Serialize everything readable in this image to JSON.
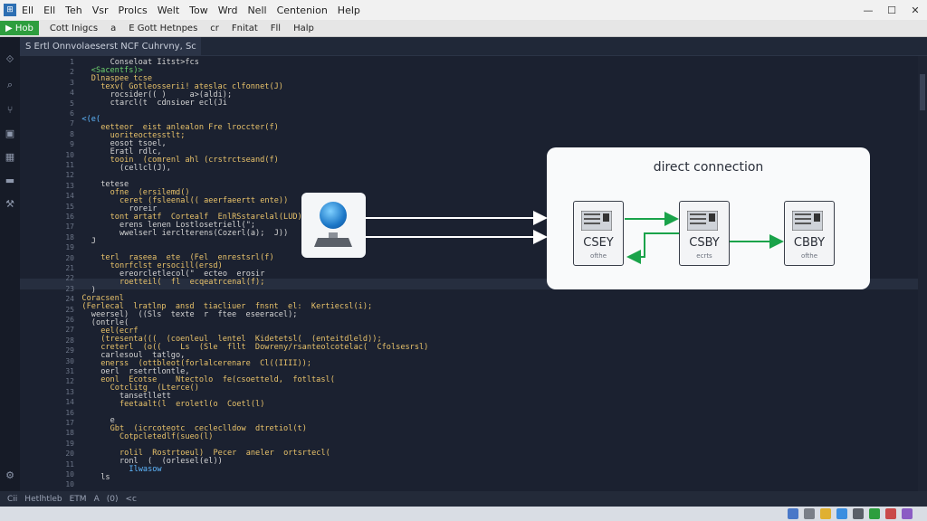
{
  "menubar": {
    "logo": "⊞",
    "items": [
      "Ell",
      "Ell",
      "Teh",
      "Vsr",
      "Prolcs",
      "Welt",
      "Tow",
      "Wrd",
      "Nell",
      "Centenion",
      "Help"
    ]
  },
  "toolbar": {
    "run_label": "Hob",
    "items": [
      "Cott Inigcs",
      "a",
      "E Gott Hetnpes",
      "cr",
      "Fnitat",
      "Fll",
      "Halp"
    ]
  },
  "tab": {
    "label": "S Ertl Onnvolaeserst NCF Cuhrvny, Sc"
  },
  "line_numbers": [
    "1",
    "2",
    "3",
    "4",
    "5",
    "6",
    "7",
    "8",
    "9",
    "10",
    "11",
    "12",
    "13",
    "14",
    "15",
    "16",
    "17",
    "18",
    "19",
    "20",
    "21",
    "22",
    "23",
    "24",
    "25",
    "26",
    "27",
    "28",
    "29",
    "30",
    "31",
    "12",
    "13",
    "14",
    "16",
    "17",
    "18",
    "19",
    "20",
    "11",
    "10",
    "10"
  ],
  "code_lines": [
    {
      "indent": 8,
      "text": "Conseloat Iitst>fcs",
      "color": "#d4d4d4"
    },
    {
      "indent": 4,
      "text": "<Sacentfs)>",
      "color": "#6fd36f"
    },
    {
      "indent": 4,
      "text": "Dlnaspee tcse",
      "color": "#e8c26a"
    },
    {
      "indent": 6,
      "text": "texv( Gotleosserii! ateslac clfonnet(J)",
      "color": "#e8c26a"
    },
    {
      "indent": 8,
      "text": "rocsider(( )     a>(aldi);",
      "color": "#d4d4d4"
    },
    {
      "indent": 8,
      "text": "ctarcl(t  cdnsioer ecl(Ji",
      "color": "#d4d4d4"
    },
    {
      "indent": 0,
      "text": "",
      "color": "#d4d4d4"
    },
    {
      "indent": 2,
      "text": "<(e(",
      "color": "#5fb8ff"
    },
    {
      "indent": 6,
      "text": "eetteor  eist anlealon Fre lroccter(f)",
      "color": "#e8c26a"
    },
    {
      "indent": 8,
      "text": "uoriteoctesstlt;",
      "color": "#e8c26a"
    },
    {
      "indent": 8,
      "text": "eosot tsoel,",
      "color": "#d4d4d4"
    },
    {
      "indent": 8,
      "text": "Eratl rdlc,",
      "color": "#d4d4d4"
    },
    {
      "indent": 8,
      "text": "tooin  (comrenl ahl (crstrctseand(f)",
      "color": "#e8c26a"
    },
    {
      "indent": 10,
      "text": "(cellcl(J),",
      "color": "#d4d4d4"
    },
    {
      "indent": 0,
      "text": "",
      "color": "#d4d4d4"
    },
    {
      "indent": 6,
      "text": "tetese",
      "color": "#d4d4d4"
    },
    {
      "indent": 8,
      "text": "ofne  (ersilemd()",
      "color": "#e8c26a"
    },
    {
      "indent": 10,
      "text": "ceret (fsleenal(( aeerfaeertt ente))",
      "color": "#e8c26a"
    },
    {
      "indent": 12,
      "text": "roreir",
      "color": "#d4d4d4"
    },
    {
      "indent": 8,
      "text": "tont artatf  Cortealf  EnlRSstarelal(LUD);",
      "color": "#e8c26a"
    },
    {
      "indent": 10,
      "text": "erens lenen Lostlosetriell(\";",
      "color": "#d4d4d4"
    },
    {
      "indent": 10,
      "text": "wwelserl ierclterens(Cozerl(a);  J))",
      "color": "#d4d4d4"
    },
    {
      "indent": 4,
      "text": "J",
      "color": "#d4d4d4"
    },
    {
      "indent": 0,
      "text": "",
      "color": "#d4d4d4"
    },
    {
      "indent": 6,
      "text": "terl  raseea  ete  (Fel  enrestsrl(f)",
      "color": "#e8c26a"
    },
    {
      "indent": 8,
      "text": "tonrfclst ersocill(ersd)",
      "color": "#e8c26a"
    },
    {
      "indent": 10,
      "text": "ereorcletlecol(\"  ecteo  erosir",
      "color": "#d4d4d4"
    },
    {
      "indent": 10,
      "text": "roetteil(  fl  ecqeatrcenal(f);",
      "color": "#e8c26a"
    },
    {
      "indent": 4,
      "text": ")",
      "color": "#d4d4d4"
    },
    {
      "indent": 2,
      "text": "Coracsenl",
      "color": "#e8c26a"
    },
    {
      "indent": 2,
      "text": "(Ferlecal  lratlnp  ansd  tiacliuer  fnsnt  el:  Kertiecsl(i);",
      "color": "#e8c26a"
    },
    {
      "indent": 4,
      "text": "weersel)  ((Sls  texte  r  ftee  eseeracel);",
      "color": "#d4d4d4"
    },
    {
      "indent": 4,
      "text": "(ontrle(",
      "color": "#d4d4d4"
    },
    {
      "indent": 6,
      "text": "eel(ecrf",
      "color": "#e8c26a"
    },
    {
      "indent": 6,
      "text": "(tresenta(((  (coenleul  lentel  Kidetetsl(  (enteitdleld));",
      "color": "#e8c26a"
    },
    {
      "indent": 6,
      "text": "creterl  (o((    Ls  (Sle  fllt  Dowreny/rsanteolcotelac(  Cfolsesrsl)",
      "color": "#e8c26a"
    },
    {
      "indent": 6,
      "text": "carlesoul  tatlgo,",
      "color": "#d4d4d4"
    },
    {
      "indent": 6,
      "text": "enerss  (ottbleot(forlalcerenare  Cl((IIII));",
      "color": "#e8c26a"
    },
    {
      "indent": 6,
      "text": "oerl  rsetrtlontle,",
      "color": "#d4d4d4"
    },
    {
      "indent": 6,
      "text": "eonl  Ecotse    Ntectolo  fe(csoetteld,  fotltasl(",
      "color": "#e8c26a"
    },
    {
      "indent": 8,
      "text": "Cotclitg  (Lterce()",
      "color": "#e8c26a"
    },
    {
      "indent": 10,
      "text": "tansetllett",
      "color": "#d4d4d4"
    },
    {
      "indent": 10,
      "text": "feetaalt(l  eroletl(o  Coetl(l)",
      "color": "#e8c26a"
    },
    {
      "indent": 0,
      "text": "",
      "color": "#d4d4d4"
    },
    {
      "indent": 8,
      "text": "e",
      "color": "#d4d4d4"
    },
    {
      "indent": 8,
      "text": "Gbt  (icrcoteotc  cecleclldow  dtretiol(t)",
      "color": "#e8c26a"
    },
    {
      "indent": 10,
      "text": "Cotpcletedlf(sueo(l)",
      "color": "#e8c26a"
    },
    {
      "indent": 0,
      "text": "",
      "color": "#d4d4d4"
    },
    {
      "indent": 10,
      "text": "rolil  Rostrtoeul)  Pecer  aneler  ortsrtecl(",
      "color": "#e8c26a"
    },
    {
      "indent": 10,
      "text": "ronl  (  (orlesel(el))",
      "color": "#d4d4d4"
    },
    {
      "indent": 12,
      "text": "Ilwasow",
      "color": "#5fb8ff"
    },
    {
      "indent": 6,
      "text": "ls",
      "color": "#d4d4d4"
    }
  ],
  "diagram": {
    "title": "direct connection",
    "nodes": [
      {
        "label": "CSEY",
        "sub": "ofthe"
      },
      {
        "label": "CSBY",
        "sub": "ecrts"
      },
      {
        "label": "CBBY",
        "sub": "ofthe"
      }
    ],
    "colors": {
      "arrow_main": "#ffffff",
      "arrow_link": "#1aa34a"
    }
  },
  "statusbar": {
    "items": [
      "Cii",
      "Hetlhtleb",
      "ETM",
      "A",
      "(0)",
      "<c"
    ]
  },
  "colors": {
    "editor_bg": "#1b2130",
    "accent": "#2e9e3e"
  }
}
